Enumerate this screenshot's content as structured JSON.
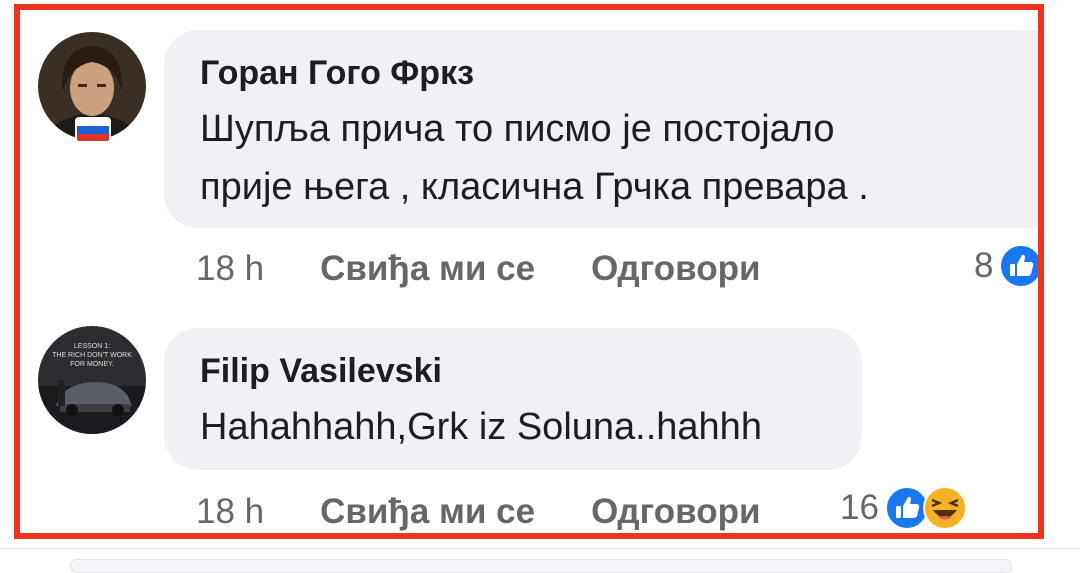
{
  "colors": {
    "frame_border": "#f0331f",
    "bubble_bg": "#eff1f4",
    "like_blue": "#1877f2",
    "haha_yellow": "#f7b125",
    "meta_gray": "#65676b"
  },
  "comments": [
    {
      "author": "Горан Гого Фркз",
      "text_lines": [
        "Шупља прича то писмо је постојало",
        "прије њега , класична Грчка превара ."
      ],
      "avatar_badge": "russia-flag",
      "time": "18 h",
      "like_label": "Свиђа ми се",
      "reply_label": "Одговори",
      "reaction_count": "8",
      "reactions": [
        "like-icon"
      ]
    },
    {
      "author": "Filip Vasilevski",
      "text_lines": [
        "Hahahhahh,Grk iz Soluna..hahhh"
      ],
      "avatar_caption": "LESSON 1: THE RICH DON'T WORK FOR MONEY.",
      "time": "18 h",
      "like_label": "Свиђа ми се",
      "reply_label": "Одговори",
      "reaction_count": "16",
      "reactions": [
        "like-icon",
        "haha-icon"
      ]
    }
  ]
}
